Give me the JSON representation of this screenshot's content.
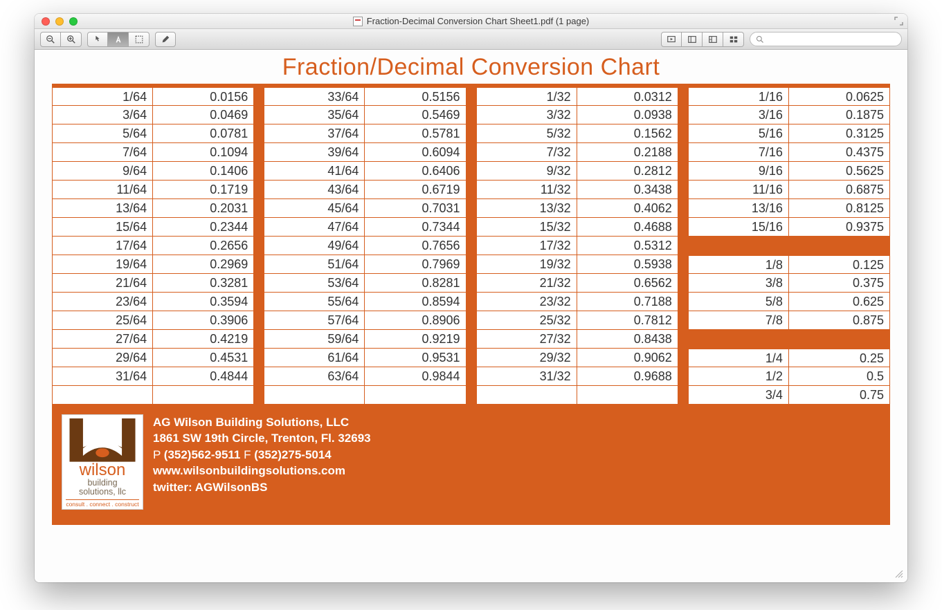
{
  "window": {
    "title": "Fraction-Decimal Conversion Chart Sheet1.pdf (1 page)"
  },
  "search": {
    "placeholder": ""
  },
  "doc": {
    "title": "Fraction/Decimal Conversion Chart"
  },
  "col64a": [
    {
      "f": "1/64",
      "d": "0.0156"
    },
    {
      "f": "3/64",
      "d": "0.0469"
    },
    {
      "f": "5/64",
      "d": "0.0781"
    },
    {
      "f": "7/64",
      "d": "0.1094"
    },
    {
      "f": "9/64",
      "d": "0.1406"
    },
    {
      "f": "11/64",
      "d": "0.1719"
    },
    {
      "f": "13/64",
      "d": "0.2031"
    },
    {
      "f": "15/64",
      "d": "0.2344"
    },
    {
      "f": "17/64",
      "d": "0.2656"
    },
    {
      "f": "19/64",
      "d": "0.2969"
    },
    {
      "f": "21/64",
      "d": "0.3281"
    },
    {
      "f": "23/64",
      "d": "0.3594"
    },
    {
      "f": "25/64",
      "d": "0.3906"
    },
    {
      "f": "27/64",
      "d": "0.4219"
    },
    {
      "f": "29/64",
      "d": "0.4531"
    },
    {
      "f": "31/64",
      "d": "0.4844"
    }
  ],
  "col64b": [
    {
      "f": "33/64",
      "d": "0.5156"
    },
    {
      "f": "35/64",
      "d": "0.5469"
    },
    {
      "f": "37/64",
      "d": "0.5781"
    },
    {
      "f": "39/64",
      "d": "0.6094"
    },
    {
      "f": "41/64",
      "d": "0.6406"
    },
    {
      "f": "43/64",
      "d": "0.6719"
    },
    {
      "f": "45/64",
      "d": "0.7031"
    },
    {
      "f": "47/64",
      "d": "0.7344"
    },
    {
      "f": "49/64",
      "d": "0.7656"
    },
    {
      "f": "51/64",
      "d": "0.7969"
    },
    {
      "f": "53/64",
      "d": "0.8281"
    },
    {
      "f": "55/64",
      "d": "0.8594"
    },
    {
      "f": "57/64",
      "d": "0.8906"
    },
    {
      "f": "59/64",
      "d": "0.9219"
    },
    {
      "f": "61/64",
      "d": "0.9531"
    },
    {
      "f": "63/64",
      "d": "0.9844"
    }
  ],
  "col32": [
    {
      "f": "1/32",
      "d": "0.0312"
    },
    {
      "f": "3/32",
      "d": "0.0938"
    },
    {
      "f": "5/32",
      "d": "0.1562"
    },
    {
      "f": "7/32",
      "d": "0.2188"
    },
    {
      "f": "9/32",
      "d": "0.2812"
    },
    {
      "f": "11/32",
      "d": "0.3438"
    },
    {
      "f": "13/32",
      "d": "0.4062"
    },
    {
      "f": "15/32",
      "d": "0.4688"
    },
    {
      "f": "17/32",
      "d": "0.5312"
    },
    {
      "f": "19/32",
      "d": "0.5938"
    },
    {
      "f": "21/32",
      "d": "0.6562"
    },
    {
      "f": "23/32",
      "d": "0.7188"
    },
    {
      "f": "25/32",
      "d": "0.7812"
    },
    {
      "f": "27/32",
      "d": "0.8438"
    },
    {
      "f": "29/32",
      "d": "0.9062"
    },
    {
      "f": "31/32",
      "d": "0.9688"
    }
  ],
  "col16": [
    {
      "f": "1/16",
      "d": "0.0625"
    },
    {
      "f": "3/16",
      "d": "0.1875"
    },
    {
      "f": "5/16",
      "d": "0.3125"
    },
    {
      "f": "7/16",
      "d": "0.4375"
    },
    {
      "f": "9/16",
      "d": "0.5625"
    },
    {
      "f": "11/16",
      "d": "0.6875"
    },
    {
      "f": "13/16",
      "d": "0.8125"
    },
    {
      "f": "15/16",
      "d": "0.9375"
    }
  ],
  "col8": [
    {
      "f": "1/8",
      "d": "0.125"
    },
    {
      "f": "3/8",
      "d": "0.375"
    },
    {
      "f": "5/8",
      "d": "0.625"
    },
    {
      "f": "7/8",
      "d": "0.875"
    }
  ],
  "colq": [
    {
      "f": "1/4",
      "d": "0.25"
    },
    {
      "f": "1/2",
      "d": "0.5"
    },
    {
      "f": "3/4",
      "d": "0.75"
    }
  ],
  "footer": {
    "company": "AG Wilson Building Solutions, LLC",
    "address": "1861 SW 19th Circle, Trenton, Fl. 32693",
    "phone_label_p": "P",
    "phone": "(352)562-9511",
    "phone_label_f": "F",
    "fax": "(352)275-5014",
    "web": "www.wilsonbuildingsolutions.com",
    "twitter": "twitter: AGWilsonBS",
    "logo_main": "wilson",
    "logo_sub": "building\nsolutions, llc",
    "logo_tag": "consult . connect . construct"
  }
}
